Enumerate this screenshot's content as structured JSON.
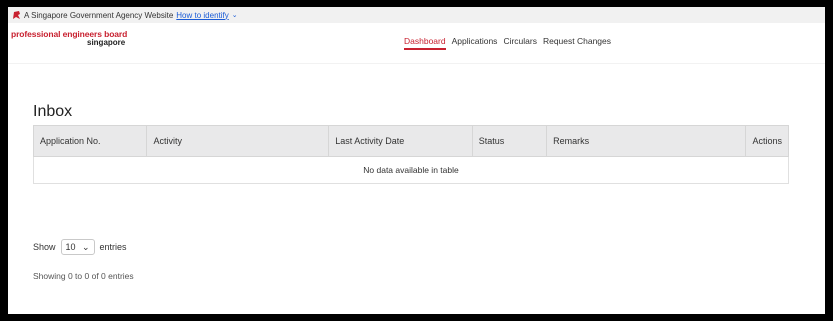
{
  "masthead": {
    "text": "A Singapore Government Agency Website",
    "link": "How to identify",
    "chevron": "⌄"
  },
  "brand": {
    "line1": "professional engineers board",
    "line2": "singapore"
  },
  "nav": {
    "tabs": [
      {
        "label": "Dashboard",
        "active": true
      },
      {
        "label": "Applications"
      },
      {
        "label": "Circulars"
      },
      {
        "label": "Request Changes"
      }
    ]
  },
  "inbox": {
    "title": "Inbox",
    "columns": [
      "Application No.",
      "Activity",
      "Last Activity Date",
      "Status",
      "Remarks",
      "Actions"
    ],
    "empty_message": "No data available in table"
  },
  "length_menu": {
    "prefix": "Show",
    "value": "10",
    "chevron": "⌄",
    "suffix": "entries"
  },
  "info": "Showing 0 to 0 of 0 entries",
  "colors": {
    "brand_red": "#c8202f",
    "link_blue": "#1a5bd6",
    "header_gray": "#e9e9ea"
  }
}
